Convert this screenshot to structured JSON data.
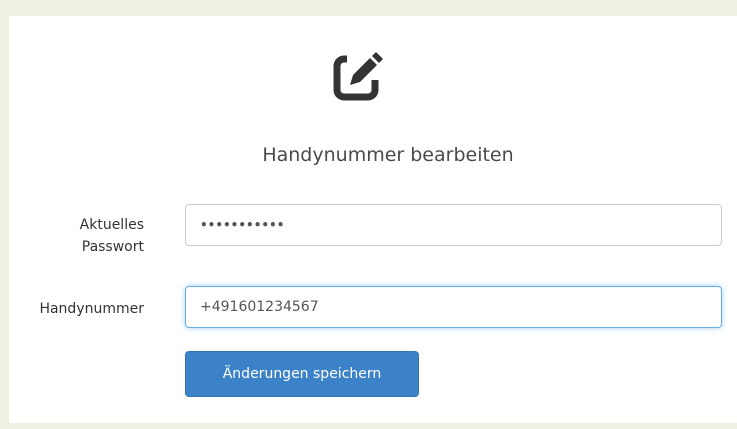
{
  "icon": "edit-icon",
  "form": {
    "title": "Handynummer bearbeiten",
    "current_password": {
      "label": "Aktuelles Passwort",
      "value": "•••••••••••"
    },
    "phone": {
      "label": "Handynummer",
      "value": "+491601234567"
    },
    "save_label": "Änderungen speichern"
  },
  "colors": {
    "background": "#eef0e4",
    "primary_button": "#3b82c9",
    "focus_border": "#66afe9",
    "icon": "#333333"
  }
}
